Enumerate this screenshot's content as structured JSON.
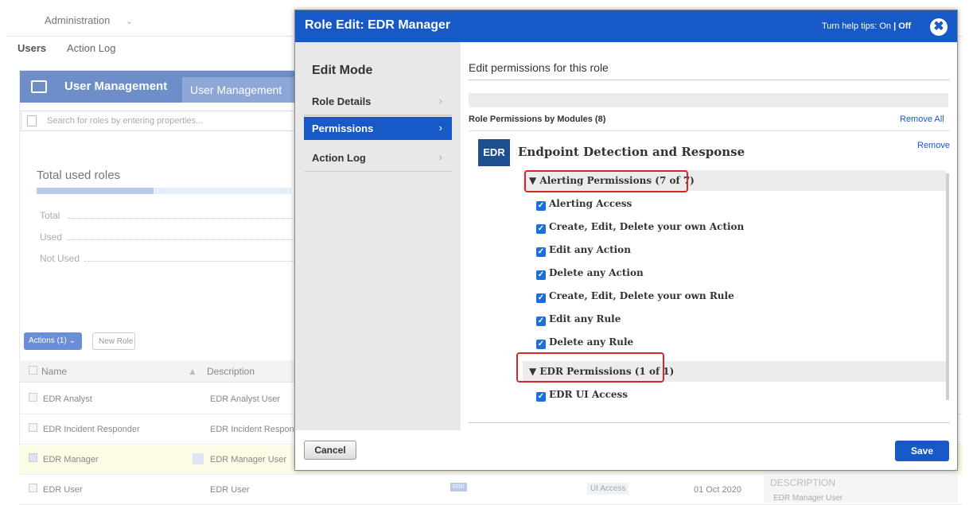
{
  "background": {
    "nav": {
      "menu": "Administration",
      "tabs": [
        "Users",
        "Action Log"
      ]
    },
    "panel": {
      "title": "User Management",
      "tab": "User Management"
    },
    "search_placeholder": "Search for roles by entering properties...",
    "stats": {
      "heading": "Total used roles",
      "labels": [
        "Total",
        "Used",
        "Not Used"
      ]
    },
    "actions_button": "Actions (1)",
    "new_role_button": "New Role",
    "columns": [
      "Name",
      "Description"
    ],
    "rows": [
      {
        "name": "EDR Analyst",
        "description": "EDR Analyst User"
      },
      {
        "name": "EDR Incident Responder",
        "description": "EDR Incident Respond"
      },
      {
        "name": "EDR Manager",
        "description": "EDR Manager User"
      },
      {
        "name": "EDR User",
        "description": "EDR User",
        "badge": "EDR",
        "chip": "UI Access",
        "date": "01 Oct 2020"
      }
    ],
    "description_panel": {
      "heading": "DESCRIPTION",
      "value": "EDR Manager User"
    }
  },
  "dialog": {
    "title": "Role Edit: EDR Manager",
    "help_tips_prefix": "Turn help tips:",
    "help_on": "On",
    "help_sep": "|",
    "help_off": "Off",
    "close_symbol": "✖",
    "sidebar": {
      "title": "Edit Mode",
      "items": [
        {
          "label": "Role Details",
          "active": false
        },
        {
          "label": "Permissions",
          "active": true
        },
        {
          "label": "Action Log",
          "active": false
        }
      ]
    },
    "main": {
      "heading": "Edit permissions for this role",
      "modules_header": "Role Permissions by Modules (8)",
      "remove_all": "Remove All",
      "module": {
        "badge": "EDR",
        "name": "Endpoint Detection and Response",
        "remove": "Remove"
      },
      "groups": [
        {
          "label": "▼ Alerting Permissions (7 of 7)",
          "items": [
            "Alerting Access",
            "Create, Edit, Delete your own Action",
            "Edit any Action",
            "Delete any Action",
            "Create, Edit, Delete your own Rule",
            "Edit any Rule",
            "Delete any Rule"
          ]
        },
        {
          "label": "▼ EDR Permissions (1 of 1)",
          "items": [
            "EDR UI Access"
          ]
        }
      ]
    },
    "cancel": "Cancel",
    "save": "Save"
  },
  "colors": {
    "brand_blue": "#1659c7",
    "highlight_red": "#d2282a",
    "module_badge": "#1d4f8f"
  },
  "icons": [
    "chevron-down-icon",
    "user-card-icon",
    "search-icon",
    "close-icon",
    "chevron-right-icon",
    "checkbox-checked-icon",
    "triangle-down-icon"
  ]
}
